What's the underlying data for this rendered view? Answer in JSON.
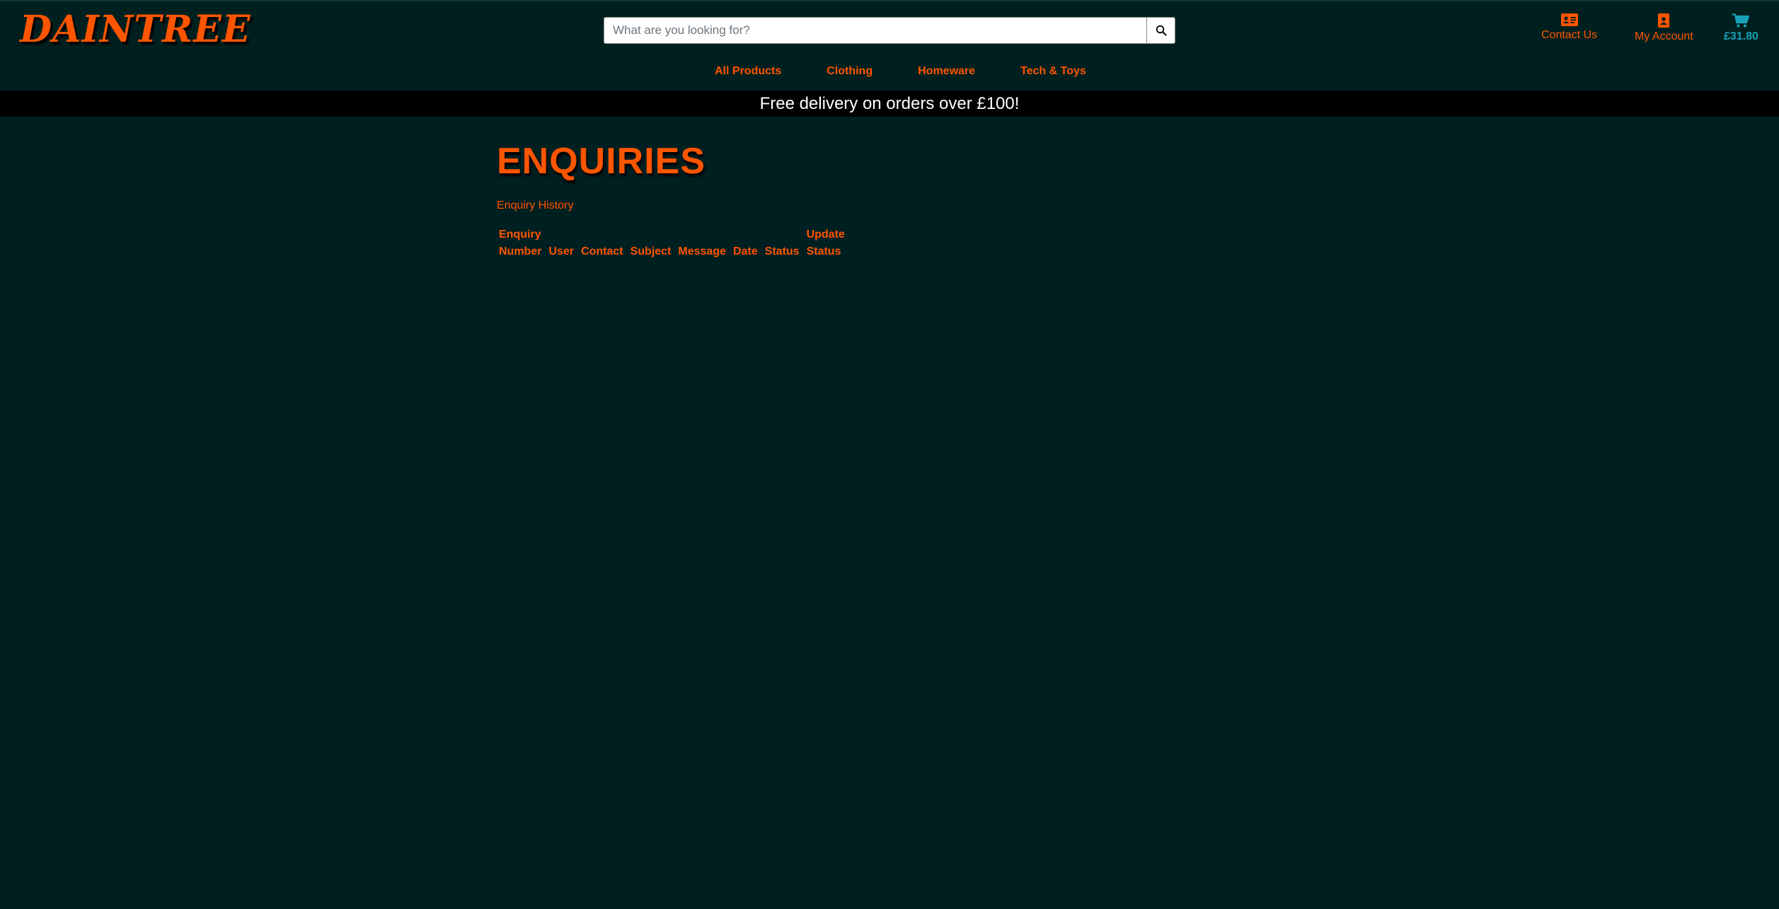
{
  "header": {
    "logo_text": "DAINTREE",
    "search": {
      "placeholder": "What are you looking for?",
      "value": ""
    },
    "search_button_icon": "search-icon",
    "contact": {
      "label": "Contact Us",
      "icon": "contact-card-icon"
    },
    "account": {
      "label": "My Account",
      "icon": "account-badge-icon"
    },
    "cart": {
      "total": "£31.80",
      "icon": "cart-icon"
    }
  },
  "nav": {
    "items": [
      {
        "label": "All Products"
      },
      {
        "label": "Clothing"
      },
      {
        "label": "Homeware"
      },
      {
        "label": "Tech & Toys"
      }
    ]
  },
  "promo": {
    "text": "Free delivery on orders over £100!"
  },
  "main": {
    "title": "ENQUIRIES",
    "subtitle": "Enquiry History",
    "table": {
      "columns": [
        {
          "line1": "Enquiry",
          "line2": "Number"
        },
        {
          "line1": "",
          "line2": "User"
        },
        {
          "line1": "",
          "line2": "Contact"
        },
        {
          "line1": "",
          "line2": "Subject"
        },
        {
          "line1": "",
          "line2": "Message"
        },
        {
          "line1": "",
          "line2": "Date"
        },
        {
          "line1": "",
          "line2": "Status"
        },
        {
          "line1": "Update",
          "line2": "Status"
        }
      ],
      "rows": []
    }
  },
  "colors": {
    "accent": "#ff5500",
    "background": "#001f21",
    "cart": "#17a2b8",
    "promo_bg": "#000000"
  }
}
